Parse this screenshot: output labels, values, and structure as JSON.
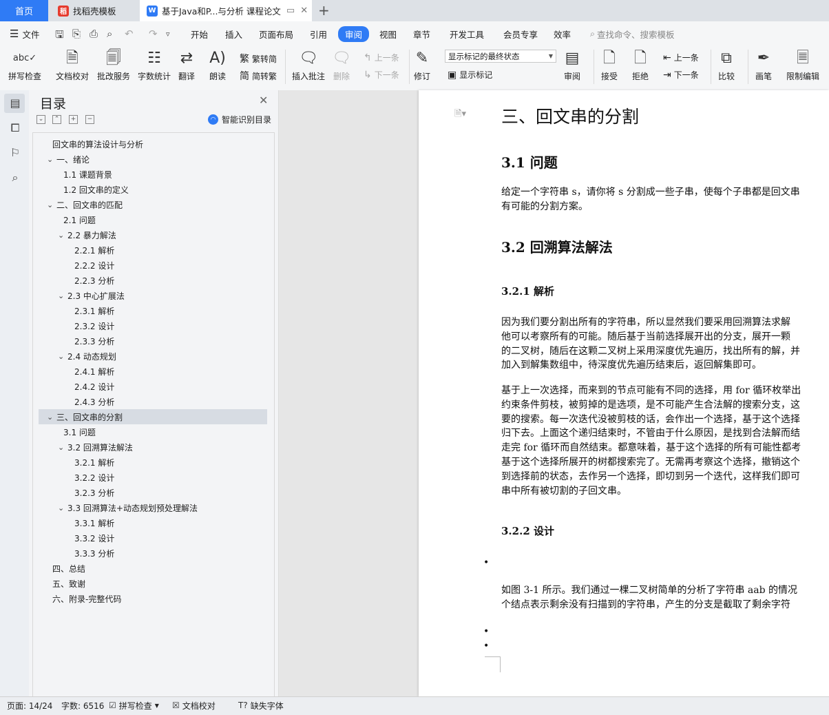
{
  "tabs": {
    "home": "首页",
    "template": "找稻壳模板",
    "document": "基于Java和P...与分析 课程论文"
  },
  "menu": {
    "file": "文件",
    "items": [
      "开始",
      "插入",
      "页面布局",
      "引用",
      "审阅",
      "视图",
      "章节",
      "开发工具",
      "会员专享",
      "效率"
    ],
    "active": "审阅",
    "search": "查找命令、搜索模板"
  },
  "ribbon": {
    "spell_check": "拼写检查",
    "doc_proof": "文档校对",
    "batch_service": "批改服务",
    "word_count": "字数统计",
    "translate": "翻译",
    "read_aloud": "朗读",
    "to_traditional": "繁转简",
    "to_simplified": "简转繁",
    "insert_comment": "插入批注",
    "delete": "删除",
    "prev_comment": "上一条",
    "next_comment": "下一条",
    "track_changes": "修订",
    "markup_mode": "显示标记的最终状态",
    "show_markup": "显示标记",
    "review": "审阅",
    "accept": "接受",
    "reject": "拒绝",
    "prev_change": "上一条",
    "next_change": "下一条",
    "compare": "比较",
    "pen": "画笔",
    "restrict_edit": "限制编辑"
  },
  "toc": {
    "title": "目录",
    "smart": "智能识别目录",
    "items": [
      {
        "text": "回文串的算法设计与分析",
        "level": 0,
        "chevron": false
      },
      {
        "text": "一、绪论",
        "level": 0,
        "chevron": true
      },
      {
        "text": "1.1  课题背景",
        "level": 1,
        "chevron": false
      },
      {
        "text": "1.2  回文串的定义",
        "level": 1,
        "chevron": false
      },
      {
        "text": "二、回文串的匹配",
        "level": 0,
        "chevron": true
      },
      {
        "text": "2.1  问题",
        "level": 1,
        "chevron": false
      },
      {
        "text": "2.2  暴力解法",
        "level": 1,
        "chevron": true
      },
      {
        "text": "2.2.1  解析",
        "level": 2,
        "chevron": false
      },
      {
        "text": "2.2.2  设计",
        "level": 2,
        "chevron": false
      },
      {
        "text": "2.2.3  分析",
        "level": 2,
        "chevron": false
      },
      {
        "text": "2.3  中心扩展法",
        "level": 1,
        "chevron": true
      },
      {
        "text": "2.3.1  解析",
        "level": 2,
        "chevron": false
      },
      {
        "text": "2.3.2  设计",
        "level": 2,
        "chevron": false
      },
      {
        "text": "2.3.3  分析",
        "level": 2,
        "chevron": false
      },
      {
        "text": "2.4  动态规划",
        "level": 1,
        "chevron": true
      },
      {
        "text": "2.4.1  解析",
        "level": 2,
        "chevron": false
      },
      {
        "text": "2.4.2  设计",
        "level": 2,
        "chevron": false
      },
      {
        "text": "2.4.3  分析",
        "level": 2,
        "chevron": false
      },
      {
        "text": "三、回文串的分割",
        "level": 0,
        "chevron": true,
        "selected": true
      },
      {
        "text": "3.1  问题",
        "level": 1,
        "chevron": false
      },
      {
        "text": "3.2  回溯算法解法",
        "level": 1,
        "chevron": true
      },
      {
        "text": "3.2.1  解析",
        "level": 2,
        "chevron": false
      },
      {
        "text": "3.2.2  设计",
        "level": 2,
        "chevron": false
      },
      {
        "text": "3.2.3  分析",
        "level": 2,
        "chevron": false
      },
      {
        "text": "3.3  回溯算法+动态规划预处理解法",
        "level": 1,
        "chevron": true
      },
      {
        "text": "3.3.1  解析",
        "level": 2,
        "chevron": false
      },
      {
        "text": "3.3.2  设计",
        "level": 2,
        "chevron": false
      },
      {
        "text": "3.3.3  分析",
        "level": 2,
        "chevron": false
      },
      {
        "text": "四、总结",
        "level": 0,
        "chevron": false
      },
      {
        "text": "五、致谢",
        "level": 0,
        "chevron": false
      },
      {
        "text": "六、附录-完整代码",
        "level": 0,
        "chevron": false
      }
    ]
  },
  "document": {
    "h1": "三、回文串的分割",
    "h31": "3.1  问题",
    "p1": [
      "给定一个字符串 s，请你将 s 分割成一些子串，使每个子串都是回文串",
      "有可能的分割方案。"
    ],
    "h32": "3.2  回溯算法解法",
    "h321": "3.2.1  解析",
    "p2": [
      "因为我们要分割出所有的字符串，所以显然我们要采用回溯算法求解",
      "他可以考察所有的可能。随后基于当前选择展开出的分支，展开一颗",
      "的二叉树，随后在这颗二叉树上采用深度优先遍历，找出所有的解，并",
      "加入到解集数组中，待深度优先遍历结束后，返回解集即可。"
    ],
    "p3": [
      "基于上一次选择，而来到的节点可能有不同的选择，用 for 循环枚举出",
      "约束条件剪枝，被剪掉的是选项，是不可能产生合法解的搜索分支，这",
      "要的搜索。每一次迭代没被剪枝的话，会作出一个选择，基于这个选择",
      "归下去。上面这个递归结束时，不管由于什么原因，是找到合法解而结",
      "走完 for 循环而自然结束。都意味着，基于这个选择的所有可能性都考",
      "基于这个选择所展开的树都搜索完了。无需再考察这个选择，撤销这个",
      "到选择前的状态，去作另一个选择，即切到另一个迭代，这样我们即可",
      "串中所有被切割的子回文串。"
    ],
    "h322": "3.2.2  设计",
    "p4": [
      "如图 3-1 所示。我们通过一棵二叉树简单的分析了字符串 aab 的情况",
      "个结点表示剩余没有扫描到的字符串，产生的分支是截取了剩余字符"
    ],
    "bullet": "•"
  },
  "status": {
    "page": "页面: 14/24",
    "words": "字数: 6516",
    "spell": "拼写检查",
    "proof": "文档校对",
    "missing_font": "缺失字体"
  },
  "colors": {
    "accent": "#2f7bf5"
  }
}
